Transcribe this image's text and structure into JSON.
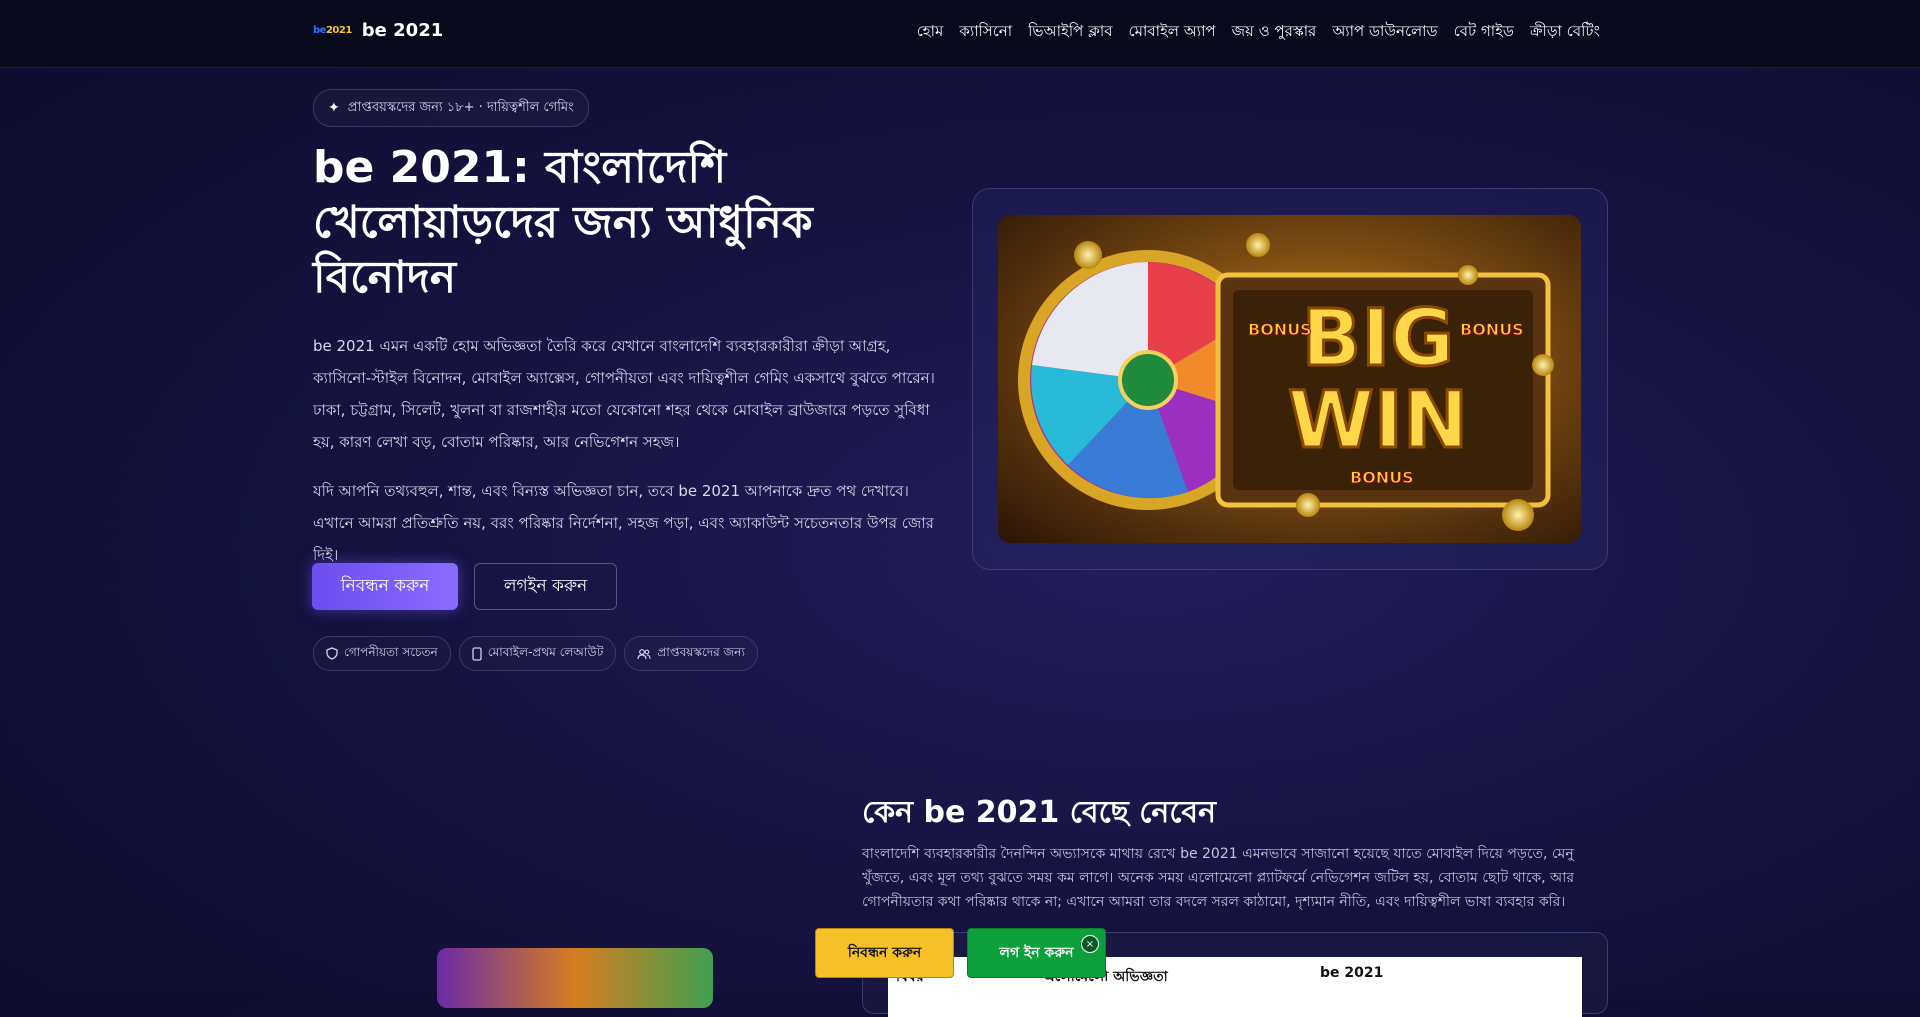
{
  "header": {
    "logo_mark_b": "be",
    "logo_mark_n": "2021",
    "logo_text": "be 2021",
    "nav": [
      "হোম",
      "ক্যাসিনো",
      "ভিআইপি ক্লাব",
      "মোবাইল অ্যাপ",
      "জয় ও পুরস্কার",
      "অ্যাপ ডাউনলোড",
      "বেট গাইড",
      "ক্রীড়া বেটিং"
    ]
  },
  "hero": {
    "pill": "প্রাপ্তবয়স্কদের জন্য ১৮+ · দায়িত্বশীল গেমিং",
    "title": "be 2021: বাংলাদেশি খেলোয়াড়দের জন্য আধুনিক বিনোদন",
    "paragraph1": "be 2021 এমন একটি হোম অভিজ্ঞতা তৈরি করে যেখানে বাংলাদেশি ব্যবহারকারীরা ক্রীড়া আগ্রহ, ক্যাসিনো-স্টাইল বিনোদন, মোবাইল অ্যাক্সেস, গোপনীয়তা এবং দায়িত্বশীল গেমিং একসাথে বুঝতে পারেন। ঢাকা, চট্টগ্রাম, সিলেট, খুলনা বা রাজশাহীর মতো যেকোনো শহর থেকে মোবাইল ব্রাউজারে পড়তে সুবিধা হয়, কারণ লেখা বড়, বোতাম পরিষ্কার, আর নেভিগেশন সহজ।",
    "paragraph2": "যদি আপনি তথ্যবহুল, শান্ত, এবং বিন্যস্ত অভিজ্ঞতা চান, তবে be 2021 আপনাকে দ্রুত পথ দেখাবে। এখানে আমরা প্রতিশ্রুতি নয়, বরং পরিষ্কার নির্দেশনা, সহজ পড়া, এবং অ্যাকাউন্ট সচেতনতার উপর জোর দিই।",
    "register_label": "নিবন্ধন করুন",
    "login_label": "লগইন করুন",
    "chips": [
      "গোপনীয়তা সচেতন",
      "মোবাইল-প্রথম লেআউট",
      "প্রাপ্তবয়স্কদের জন্য"
    ],
    "image_text_big": "BIG",
    "image_text_win": "WIN",
    "image_text_bonus": "BONUS"
  },
  "why": {
    "title": "কেন be 2021 বেছে নেবেন",
    "text": "বাংলাদেশি ব্যবহারকারীর দৈনন্দিন অভ্যাসকে মাথায় রেখে be 2021 এমনভাবে সাজানো হয়েছে যাতে মোবাইল দিয়ে পড়তে, মেনু খুঁজতে, এবং মূল তথ্য বুঝতে সময় কম লাগে। অনেক সময় এলোমেলো প্ল্যাটফর্মে নেভিগেশন জটিল হয়, বোতাম ছোট থাকে, আর গোপনীয়তার কথা পরিষ্কার থাকে না; এখানে আমরা তার বদলে সরল কাঠামো, দৃশ্যমান নীতি, এবং দায়িত্বশীল ভাষা ব্যবহার করি।",
    "table_headers": [
      "বিষয়",
      "এলোমেলো অভিজ্ঞতা",
      "be 2021"
    ]
  },
  "floating": {
    "register_label": "নিবন্ধন করুন",
    "login_label": "লগ ইন করুন",
    "close": "×"
  }
}
